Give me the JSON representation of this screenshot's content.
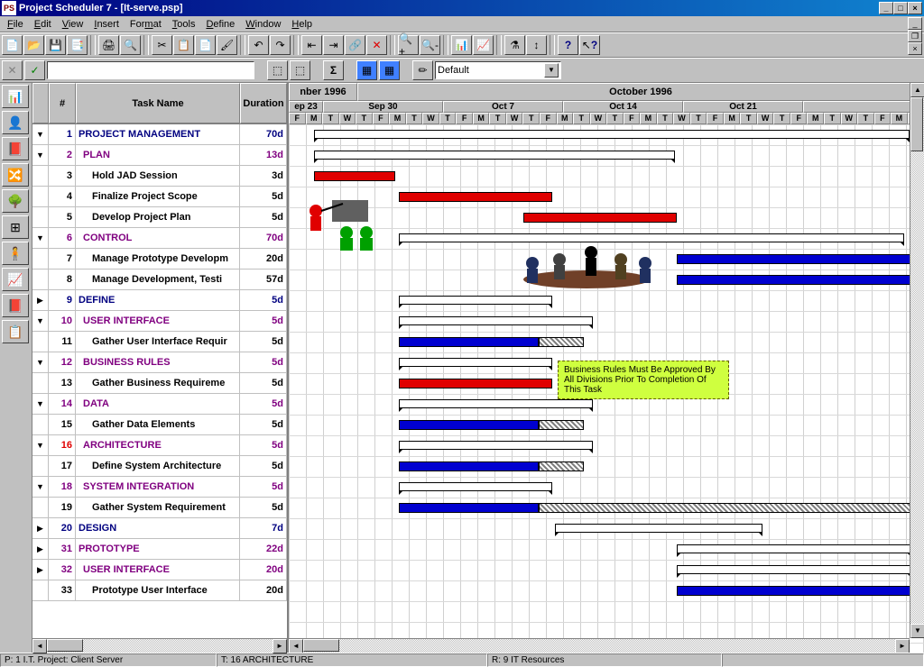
{
  "window": {
    "title": "Project Scheduler 7 - [It-serve.psp]"
  },
  "menus": [
    "File",
    "Edit",
    "View",
    "Insert",
    "Format",
    "Tools",
    "Define",
    "Window",
    "Help"
  ],
  "combo_default": "Default",
  "columns": {
    "num": "#",
    "name": "Task Name",
    "dur": "Duration"
  },
  "timeline": {
    "month1_label": "nber 1996",
    "month2_label": "October 1996",
    "weeks": [
      "ep 23",
      "Sep 30",
      "Oct 7",
      "Oct 14",
      "Oct 21"
    ],
    "day_pattern": [
      "F",
      "M",
      "T",
      "W",
      "T",
      "F",
      "M",
      "T",
      "W",
      "T",
      "F",
      "M",
      "T",
      "W",
      "T",
      "F",
      "M",
      "T",
      "W",
      "T",
      "F",
      "M",
      "T",
      "W",
      "T",
      "F",
      "M",
      "T",
      "W",
      "T",
      "F",
      "M",
      "T",
      "W",
      "T",
      "F",
      "M",
      "T"
    ]
  },
  "tasks": [
    {
      "n": 1,
      "name": "PROJECT MANAGEMENT",
      "dur": "70d",
      "lvl": 0,
      "exp": "▼",
      "cls": "c-blue"
    },
    {
      "n": 2,
      "name": "PLAN",
      "dur": "13d",
      "lvl": 1,
      "exp": "▼",
      "cls": "c-purple"
    },
    {
      "n": 3,
      "name": "Hold JAD Session",
      "dur": "3d",
      "lvl": 2,
      "exp": ""
    },
    {
      "n": 4,
      "name": "Finalize Project Scope",
      "dur": "5d",
      "lvl": 2,
      "exp": ""
    },
    {
      "n": 5,
      "name": "Develop Project Plan",
      "dur": "5d",
      "lvl": 2,
      "exp": ""
    },
    {
      "n": 6,
      "name": "CONTROL",
      "dur": "70d",
      "lvl": 1,
      "exp": "▼",
      "cls": "c-purple"
    },
    {
      "n": 7,
      "name": "Manage Prototype Developm",
      "dur": "20d",
      "lvl": 2,
      "exp": ""
    },
    {
      "n": 8,
      "name": "Manage Development, Testi",
      "dur": "57d",
      "lvl": 2,
      "exp": ""
    },
    {
      "n": 9,
      "name": "DEFINE",
      "dur": "5d",
      "lvl": 0,
      "exp": "▶",
      "cls": "c-blue"
    },
    {
      "n": 10,
      "name": "USER INTERFACE",
      "dur": "5d",
      "lvl": 1,
      "exp": "▼",
      "cls": "c-purple"
    },
    {
      "n": 11,
      "name": "Gather User Interface Requir",
      "dur": "5d",
      "lvl": 2,
      "exp": ""
    },
    {
      "n": 12,
      "name": "BUSINESS RULES",
      "dur": "5d",
      "lvl": 1,
      "exp": "▼",
      "cls": "c-purple"
    },
    {
      "n": 13,
      "name": "Gather Business Requireme",
      "dur": "5d",
      "lvl": 2,
      "exp": ""
    },
    {
      "n": 14,
      "name": "DATA",
      "dur": "5d",
      "lvl": 1,
      "exp": "▼",
      "cls": "c-purple"
    },
    {
      "n": 15,
      "name": "Gather Data Elements",
      "dur": "5d",
      "lvl": 2,
      "exp": ""
    },
    {
      "n": 16,
      "name": "ARCHITECTURE",
      "dur": "5d",
      "lvl": 1,
      "exp": "▼",
      "cls": "c-purple",
      "hl": true
    },
    {
      "n": 17,
      "name": "Define System Architecture",
      "dur": "5d",
      "lvl": 2,
      "exp": ""
    },
    {
      "n": 18,
      "name": "SYSTEM INTEGRATION",
      "dur": "5d",
      "lvl": 1,
      "exp": "▼",
      "cls": "c-purple"
    },
    {
      "n": 19,
      "name": "Gather System Requirement",
      "dur": "5d",
      "lvl": 2,
      "exp": ""
    },
    {
      "n": 20,
      "name": "DESIGN",
      "dur": "7d",
      "lvl": 0,
      "exp": "▶",
      "cls": "c-blue"
    },
    {
      "n": 31,
      "name": "PROTOTYPE",
      "dur": "22d",
      "lvl": 0,
      "exp": "▶",
      "cls": "c-purple"
    },
    {
      "n": 32,
      "name": "USER INTERFACE",
      "dur": "20d",
      "lvl": 1,
      "exp": "▶",
      "cls": "c-purple"
    },
    {
      "n": 33,
      "name": "Prototype User Interface",
      "dur": "20d",
      "lvl": 2,
      "exp": ""
    }
  ],
  "note_text": "Business Rules Must Be Approved By All Divisions Prior To Completion Of This Task",
  "status": {
    "p": "P: 1 I.T. Project: Client Server",
    "t": "T: 16 ARCHITECTURE",
    "r": "R: 9 IT Resources"
  }
}
